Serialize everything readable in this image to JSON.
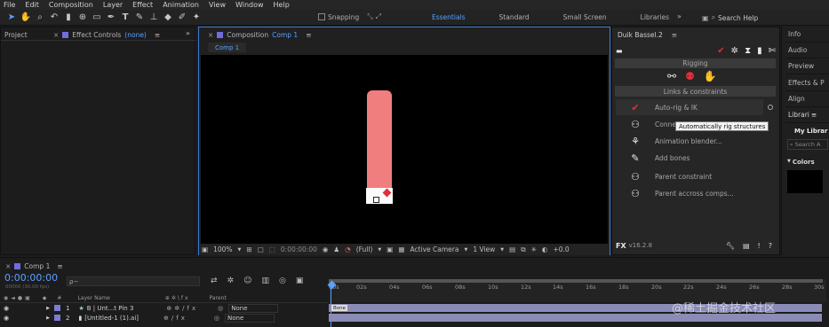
{
  "menu": [
    "File",
    "Edit",
    "Composition",
    "Layer",
    "Effect",
    "Animation",
    "View",
    "Window",
    "Help"
  ],
  "toolbar": {
    "snapping_label": "Snapping",
    "workspaces": [
      "Essentials",
      "Standard",
      "Small Screen",
      "Libraries"
    ],
    "active_workspace": "Essentials",
    "search_placeholder": "Search Help"
  },
  "left_panel": {
    "project_tab": "Project",
    "effect_controls_label": "Effect Controls",
    "effect_controls_value": "(none)"
  },
  "composition": {
    "tab_label": "Composition",
    "tab_name": "Comp 1",
    "breadcrumb": "Comp 1",
    "zoom": "100%",
    "timecode": "0:00:00:00",
    "resolution": "(Full)",
    "camera": "Active Camera",
    "view": "1 View",
    "offset": "+0.0"
  },
  "duik": {
    "title": "Duik Bassel.2",
    "section_rigging": "Rigging",
    "section_links": "Links & constraints",
    "items": [
      {
        "label": "Auto-rig & IK",
        "icon": "auto-rig-icon"
      },
      {
        "label": "Connect...",
        "icon": "connector-icon"
      },
      {
        "label": "Animation blender...",
        "icon": "blender-icon"
      },
      {
        "label": "Add bones",
        "icon": "pin-icon"
      },
      {
        "label": "Parent constraint",
        "icon": "parent-icon"
      },
      {
        "label": "Parent accross comps...",
        "icon": "parent-comps-icon"
      }
    ],
    "tooltip": "Automatically rig structures",
    "version_logo": "FX",
    "version": "v16.2.8"
  },
  "right_panel": {
    "items": [
      "Info",
      "Audio",
      "Preview",
      "Effects & P",
      "Align",
      "Librari",
      "My Librar",
      "Search A",
      "Colors"
    ]
  },
  "timeline": {
    "comp_tab": "Comp 1",
    "timecode": "0:00:00:00",
    "fps": "00000 (30.00 fps)",
    "search_placeholder": "ρ−",
    "columns": {
      "layer_name": "Layer Name",
      "parent": "Parent"
    },
    "layers": [
      {
        "num": "1",
        "name": "B | Unt...t Pin 3",
        "parent": "None",
        "color": "#7c7cd6"
      },
      {
        "num": "2",
        "name": "[Untitled-1 (1).ai]",
        "parent": "None",
        "color": "#7c7cd6"
      }
    ],
    "ruler_ticks": [
      "00s",
      "02s",
      "04s",
      "06s",
      "08s",
      "10s",
      "12s",
      "14s",
      "16s",
      "18s",
      "20s",
      "22s",
      "24s",
      "26s",
      "28s",
      "30s"
    ],
    "bar_label": "Bone",
    "watermark": "@稀土掘金技术社区"
  },
  "colors": {
    "accent": "#5aa0ff",
    "shape": "#f07e7e",
    "duik_red": "#e0303a"
  }
}
